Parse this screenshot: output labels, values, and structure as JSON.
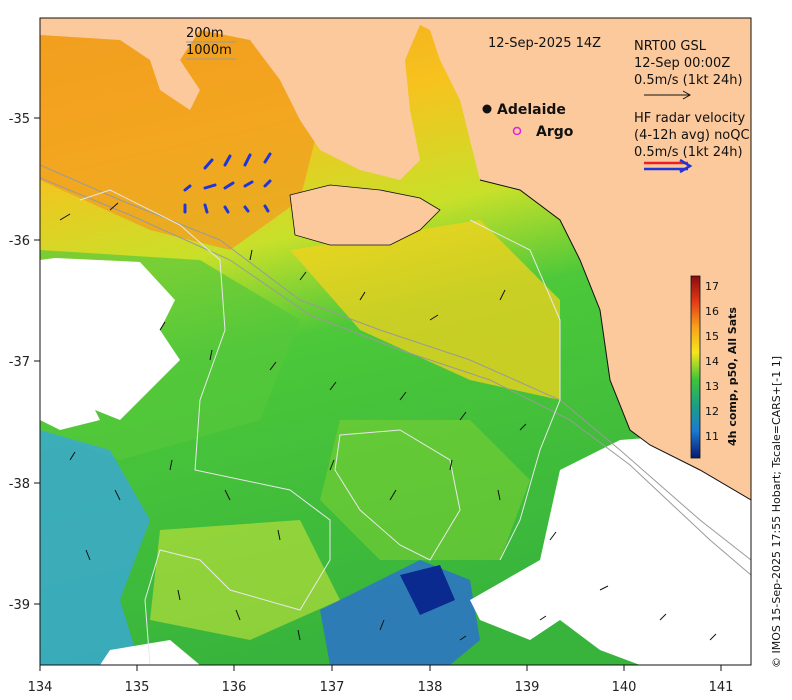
{
  "map": {
    "timestamp": "12-Sep-2025 14Z",
    "contour_legend": [
      "200m",
      "1000m"
    ],
    "gsl": {
      "line1": "NRT00 GSL",
      "line2": "12-Sep 00:00Z",
      "line3": "0.5m/s (1kt 24h)"
    },
    "hf": {
      "line1": "HF radar velocity",
      "line2": "(4-12h avg) noQC",
      "line3": "0.5m/s (1kt 24h)"
    },
    "places": {
      "adelaide": "Adelaide",
      "argo": "Argo"
    },
    "colorbar": {
      "title": "4h comp, p50, All Sats",
      "ticks": [
        "17",
        "16",
        "15",
        "14",
        "13",
        "12",
        "11"
      ]
    },
    "axes": {
      "x_ticks": [
        "134",
        "135",
        "136",
        "137",
        "138",
        "139",
        "140",
        "141"
      ],
      "y_ticks": [
        "-35",
        "-36",
        "-37",
        "-38",
        "-39"
      ]
    },
    "credit": "© IMOS 15-Sep-2025 17:55 Hobart; Tscale=CARS+[-1 1]",
    "colors": {
      "land": "#fbc99c",
      "argo": "#e020e0",
      "hf_red": "#e8202a",
      "hf_blue": "#1f35d9"
    }
  }
}
